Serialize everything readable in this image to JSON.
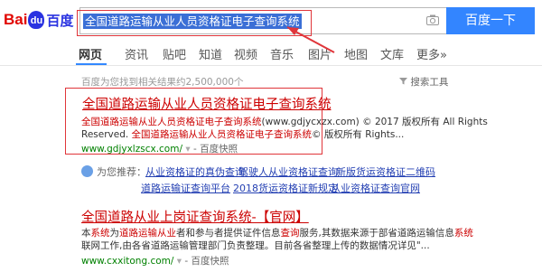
{
  "logo": {
    "bai": "Bai",
    "paw": "du",
    "cn": "百度"
  },
  "search": {
    "query": "全国道路运输从业人员资格证电子查询系统",
    "button": "百度一下",
    "camera_icon": "camera-icon"
  },
  "tabs": [
    "网页",
    "资讯",
    "贴吧",
    "知道",
    "视频",
    "音乐",
    "图片",
    "地图",
    "文库",
    "更多»"
  ],
  "active_tab": "网页",
  "result_count": "百度为您找到相关结果约2,500,000个",
  "search_tools": "搜索工具",
  "result1": {
    "title": "全国道路运输从业人员资格证电子查询系统",
    "desc1_red": "全国道路运输从业人员资格证电子查询系统",
    "desc1_rest": "(www.gdjycxzx.com) © 2017 版权所有 All Rights",
    "desc2_pre": "Reserved. ",
    "desc2_red": "全国道路运输从业人员资格证电子查询系统",
    "desc2_rest": "© 版权所有 Rights...",
    "url": "www.gdjyxlzscx.com/",
    "snapshot": "百度快照"
  },
  "recommend": {
    "label": "为您推荐：",
    "links": [
      "从业资格证的真伪查询",
      "驾驶人从业资格证查询",
      "新版货运资格证二维码",
      "道路运输证查询平台",
      "2018货运资格证新规定",
      "从业资格证查询官网"
    ]
  },
  "result2": {
    "title": "全国道路从业上岗证查询系统-【官网】",
    "desc2_a_pre": "本",
    "desc2_a_red": "系统",
    "desc2_a_mid": "为",
    "desc2_a_red2": "道路运输从业",
    "desc2_a_rest": "者和参与者提供证件信息",
    "desc2_a_red3": "查询",
    "desc2_a_rest2": "服务,其数据来源于部省道路运输信息",
    "desc2_a_red4": "系统",
    "desc2_b": "联网工作,由各省道路运输管理部门负责整理。目前各省整理上传的数据情况详见\"...",
    "url": "www.cxxitong.com/",
    "snapshot": "百度快照"
  },
  "colors": {
    "accent": "#3385ff",
    "annotation": "#e0353a",
    "title_red": "#c00000",
    "url_green": "#008000"
  }
}
